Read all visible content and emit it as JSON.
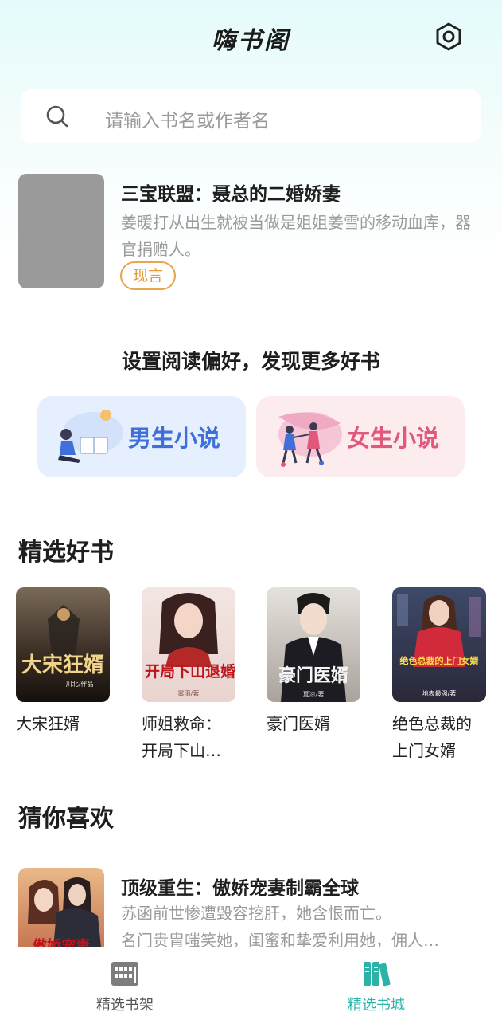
{
  "app": {
    "title": "嗨书阁"
  },
  "search": {
    "placeholder": "请输入书名或作者名"
  },
  "hero": {
    "title": "三宝联盟：聂总的二婚娇妻",
    "description": "姜暖打从出生就被当做是姐姐姜雪的移动血库，器官捐赠人。",
    "tag": "现言"
  },
  "preference": {
    "title": "设置阅读偏好，发现更多好书",
    "male_label": "男生小说",
    "female_label": "女生小说"
  },
  "picks": {
    "title": "精选好书",
    "books": [
      {
        "name": "大宋狂婿",
        "cover_text": "大宋狂婿",
        "cover_author": "川北/作品"
      },
      {
        "name": "师姐救命：开局下山…",
        "cover_text": "开局下山退婚",
        "cover_author": "雾雨/著"
      },
      {
        "name": "豪门医婿",
        "cover_text": "豪门医婿",
        "cover_author": "夏凉/著"
      },
      {
        "name": "绝色总裁的上门女婿",
        "cover_text": "绝色总裁的上门女婿",
        "cover_author": "地表最强/著"
      }
    ]
  },
  "guess": {
    "title": "猜你喜欢",
    "item": {
      "title": "顶级重生：傲娇宠妻制霸全球",
      "description_line1": "苏函前世惨遭毁容挖肝，她含恨而亡。",
      "description_line2": "名门贵胄嗤笑她，闺蜜和挚爱利用她，佣人…",
      "cover_text": "傲娇宠妻"
    }
  },
  "tabbar": {
    "shelf_label": "精选书架",
    "store_label": "精选书城",
    "active_color": "#2bb3a8"
  }
}
